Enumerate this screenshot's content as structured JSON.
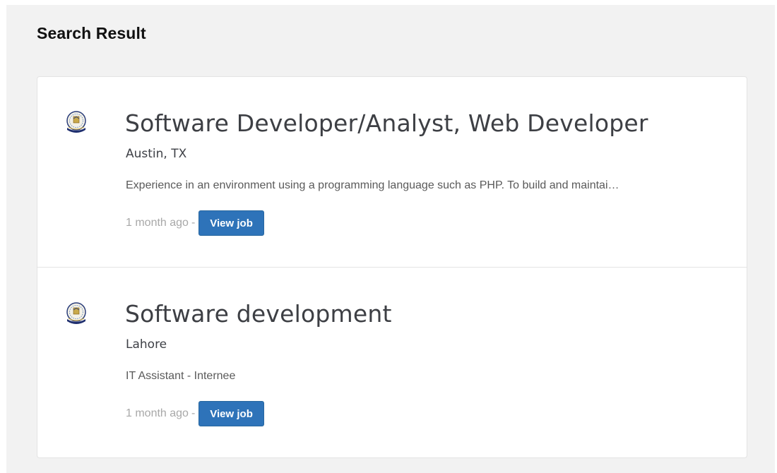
{
  "page": {
    "title": "Search Result"
  },
  "results": [
    {
      "logo_icon": "university-crest-logo",
      "title": "Software Developer/Analyst, Web Developer",
      "location": "Austin, TX",
      "description": "Experience in an environment using a programming language such as PHP. To build and maintai…",
      "posted": "1 month ago",
      "separator": "-",
      "button_label": "View job"
    },
    {
      "logo_icon": "university-crest-logo",
      "title": "Software development",
      "location": "Lahore",
      "description": "IT Assistant - Internee",
      "posted": "1 month ago",
      "separator": "-",
      "button_label": "View job"
    }
  ],
  "colors": {
    "button_bg": "#2e73b9",
    "panel_bg": "#f2f2f2",
    "title_text": "#3d3f44"
  }
}
